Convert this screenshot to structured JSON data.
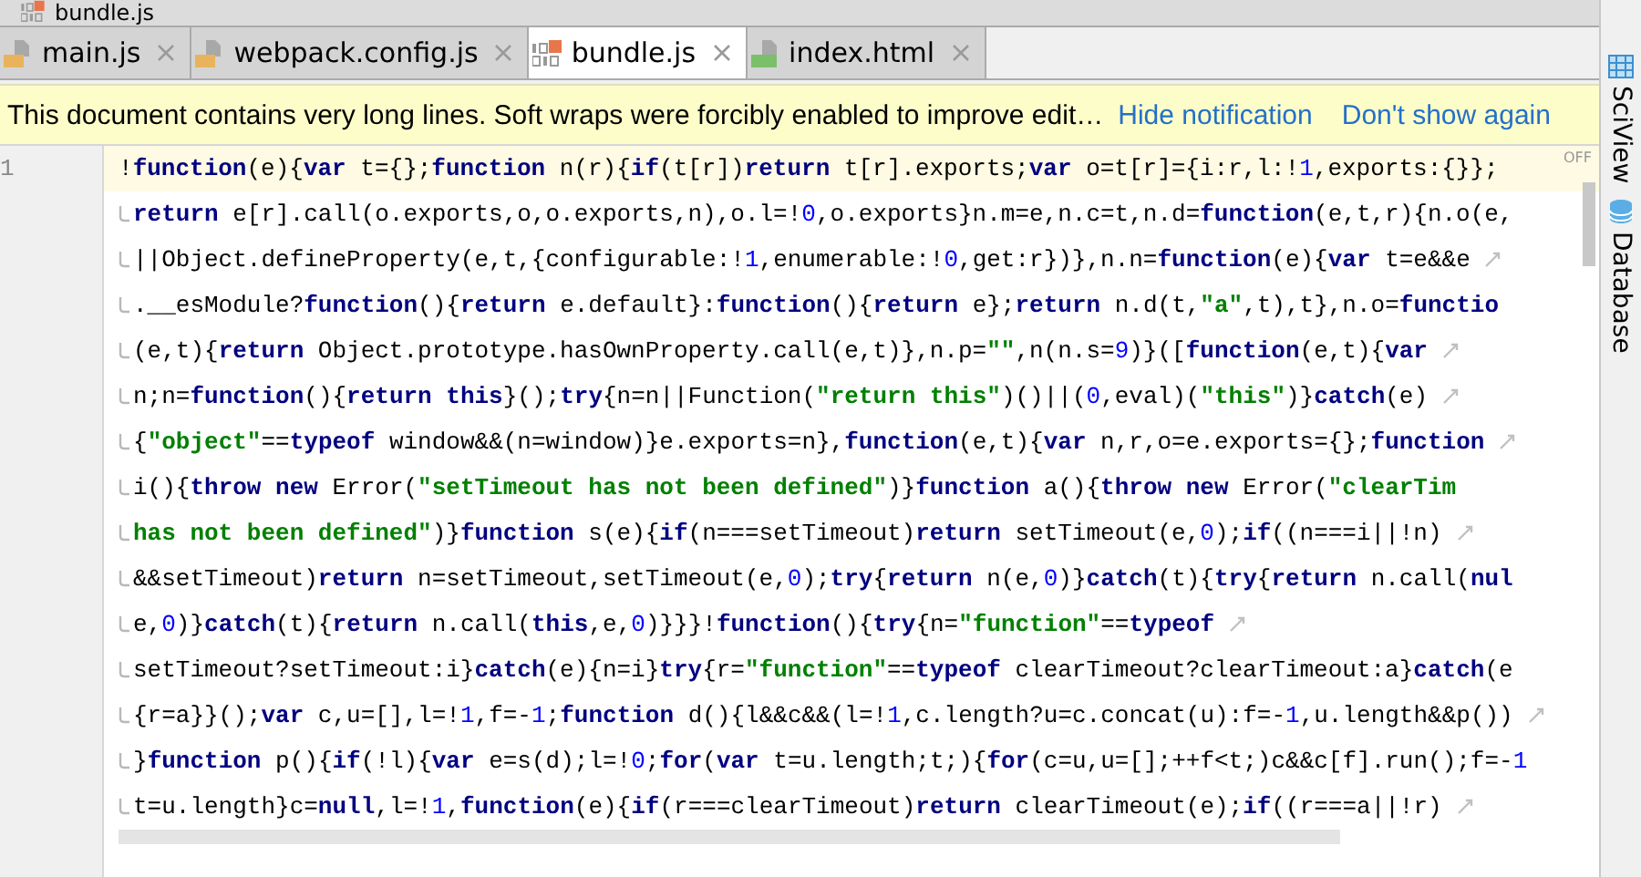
{
  "breadcrumb": {
    "label": "bundle.js",
    "kind": "binary"
  },
  "tabs": [
    {
      "label": "main.js",
      "kind": "js",
      "selected": false
    },
    {
      "label": "webpack.config.js",
      "kind": "js",
      "selected": false
    },
    {
      "label": "bundle.js",
      "kind": "binary",
      "selected": true
    },
    {
      "label": "index.html",
      "kind": "html",
      "selected": false
    }
  ],
  "notification": {
    "message": "This document contains very long lines. Soft wraps were forcibly enabled to improve edit…",
    "links": [
      "Hide notification",
      "Don't show again"
    ]
  },
  "editor": {
    "line_number": "1",
    "inspection": "OFF",
    "lines": [
      {
        "continuation": false,
        "wrap_mark": false,
        "current": true,
        "tokens": [
          {
            "kind": "plain",
            "text": "!"
          },
          {
            "kind": "keyword",
            "text": "function"
          },
          {
            "kind": "plain",
            "text": "(e){"
          },
          {
            "kind": "keyword",
            "text": "var"
          },
          {
            "kind": "plain",
            "text": " t={};"
          },
          {
            "kind": "keyword",
            "text": "function"
          },
          {
            "kind": "plain",
            "text": " n(r){"
          },
          {
            "kind": "keyword",
            "text": "if"
          },
          {
            "kind": "plain",
            "text": "(t[r])"
          },
          {
            "kind": "keyword",
            "text": "return"
          },
          {
            "kind": "plain",
            "text": " t[r].exports;"
          },
          {
            "kind": "keyword",
            "text": "var"
          },
          {
            "kind": "plain",
            "text": " o=t[r]={i:r,l:!"
          },
          {
            "kind": "number",
            "text": "1"
          },
          {
            "kind": "plain",
            "text": ",exports:{}};"
          }
        ]
      },
      {
        "continuation": true,
        "wrap_mark": false,
        "current": false,
        "tokens": [
          {
            "kind": "keyword",
            "text": "return"
          },
          {
            "kind": "plain",
            "text": " e[r].call(o.exports,o,o.exports,n),o.l=!"
          },
          {
            "kind": "number",
            "text": "0"
          },
          {
            "kind": "plain",
            "text": ",o.exports}n.m=e,n.c=t,n.d="
          },
          {
            "kind": "keyword",
            "text": "function"
          },
          {
            "kind": "plain",
            "text": "(e,t,r){n.o(e,"
          }
        ]
      },
      {
        "continuation": true,
        "wrap_mark": true,
        "current": false,
        "tokens": [
          {
            "kind": "plain",
            "text": "||Object.defineProperty(e,t,{configurable:!"
          },
          {
            "kind": "number",
            "text": "1"
          },
          {
            "kind": "plain",
            "text": ",enumerable:!"
          },
          {
            "kind": "number",
            "text": "0"
          },
          {
            "kind": "plain",
            "text": ",get:r})},n.n="
          },
          {
            "kind": "keyword",
            "text": "function"
          },
          {
            "kind": "plain",
            "text": "(e){"
          },
          {
            "kind": "keyword",
            "text": "var"
          },
          {
            "kind": "plain",
            "text": " t=e&&e"
          }
        ]
      },
      {
        "continuation": true,
        "wrap_mark": false,
        "current": false,
        "tokens": [
          {
            "kind": "plain",
            "text": ".__esModule?"
          },
          {
            "kind": "keyword",
            "text": "function"
          },
          {
            "kind": "plain",
            "text": "(){"
          },
          {
            "kind": "keyword",
            "text": "return"
          },
          {
            "kind": "plain",
            "text": " e.default}:"
          },
          {
            "kind": "keyword",
            "text": "function"
          },
          {
            "kind": "plain",
            "text": "(){"
          },
          {
            "kind": "keyword",
            "text": "return"
          },
          {
            "kind": "plain",
            "text": " e};"
          },
          {
            "kind": "keyword",
            "text": "return"
          },
          {
            "kind": "plain",
            "text": " n.d(t,"
          },
          {
            "kind": "string",
            "text": "\"a\""
          },
          {
            "kind": "plain",
            "text": ",t),t},n.o="
          },
          {
            "kind": "keyword",
            "text": "functio"
          }
        ]
      },
      {
        "continuation": true,
        "wrap_mark": true,
        "current": false,
        "tokens": [
          {
            "kind": "plain",
            "text": "(e,t){"
          },
          {
            "kind": "keyword",
            "text": "return"
          },
          {
            "kind": "plain",
            "text": " Object.prototype.hasOwnProperty.call(e,t)},n.p="
          },
          {
            "kind": "string",
            "text": "\"\""
          },
          {
            "kind": "plain",
            "text": ",n(n.s="
          },
          {
            "kind": "number",
            "text": "9"
          },
          {
            "kind": "plain",
            "text": ")}(["
          },
          {
            "kind": "keyword",
            "text": "function"
          },
          {
            "kind": "plain",
            "text": "(e,t){"
          },
          {
            "kind": "keyword",
            "text": "var"
          }
        ]
      },
      {
        "continuation": true,
        "wrap_mark": true,
        "current": false,
        "tokens": [
          {
            "kind": "plain",
            "text": "n;n="
          },
          {
            "kind": "keyword",
            "text": "function"
          },
          {
            "kind": "plain",
            "text": "(){"
          },
          {
            "kind": "keyword",
            "text": "return this"
          },
          {
            "kind": "plain",
            "text": "}();"
          },
          {
            "kind": "keyword",
            "text": "try"
          },
          {
            "kind": "plain",
            "text": "{n=n||Function("
          },
          {
            "kind": "string",
            "text": "\"return this\""
          },
          {
            "kind": "plain",
            "text": ")()||("
          },
          {
            "kind": "number",
            "text": "0"
          },
          {
            "kind": "plain",
            "text": ",eval)("
          },
          {
            "kind": "string",
            "text": "\"this\""
          },
          {
            "kind": "plain",
            "text": ")}"
          },
          {
            "kind": "keyword",
            "text": "catch"
          },
          {
            "kind": "plain",
            "text": "(e)"
          }
        ]
      },
      {
        "continuation": true,
        "wrap_mark": true,
        "current": false,
        "tokens": [
          {
            "kind": "plain",
            "text": "{"
          },
          {
            "kind": "string",
            "text": "\"object\""
          },
          {
            "kind": "plain",
            "text": "=="
          },
          {
            "kind": "keyword",
            "text": "typeof"
          },
          {
            "kind": "plain",
            "text": " window&&(n=window)}e.exports=n},"
          },
          {
            "kind": "keyword",
            "text": "function"
          },
          {
            "kind": "plain",
            "text": "(e,t){"
          },
          {
            "kind": "keyword",
            "text": "var"
          },
          {
            "kind": "plain",
            "text": " n,r,o=e.exports={};"
          },
          {
            "kind": "keyword",
            "text": "function"
          }
        ]
      },
      {
        "continuation": true,
        "wrap_mark": false,
        "current": false,
        "tokens": [
          {
            "kind": "plain",
            "text": "i(){"
          },
          {
            "kind": "keyword",
            "text": "throw new"
          },
          {
            "kind": "plain",
            "text": " Error("
          },
          {
            "kind": "string",
            "text": "\"setTimeout has not been defined\""
          },
          {
            "kind": "plain",
            "text": ")}"
          },
          {
            "kind": "keyword",
            "text": "function"
          },
          {
            "kind": "plain",
            "text": " a(){"
          },
          {
            "kind": "keyword",
            "text": "throw new"
          },
          {
            "kind": "plain",
            "text": " Error("
          },
          {
            "kind": "string",
            "text": "\"clearTim"
          }
        ]
      },
      {
        "continuation": true,
        "wrap_mark": true,
        "current": false,
        "tokens": [
          {
            "kind": "string",
            "text": "has not been defined\""
          },
          {
            "kind": "plain",
            "text": ")}"
          },
          {
            "kind": "keyword",
            "text": "function"
          },
          {
            "kind": "plain",
            "text": " s(e){"
          },
          {
            "kind": "keyword",
            "text": "if"
          },
          {
            "kind": "plain",
            "text": "(n===setTimeout)"
          },
          {
            "kind": "keyword",
            "text": "return"
          },
          {
            "kind": "plain",
            "text": " setTimeout(e,"
          },
          {
            "kind": "number",
            "text": "0"
          },
          {
            "kind": "plain",
            "text": ");"
          },
          {
            "kind": "keyword",
            "text": "if"
          },
          {
            "kind": "plain",
            "text": "((n===i||!n)"
          }
        ]
      },
      {
        "continuation": true,
        "wrap_mark": false,
        "current": false,
        "tokens": [
          {
            "kind": "plain",
            "text": "&&setTimeout)"
          },
          {
            "kind": "keyword",
            "text": "return"
          },
          {
            "kind": "plain",
            "text": " n=setTimeout,setTimeout(e,"
          },
          {
            "kind": "number",
            "text": "0"
          },
          {
            "kind": "plain",
            "text": ");"
          },
          {
            "kind": "keyword",
            "text": "try"
          },
          {
            "kind": "plain",
            "text": "{"
          },
          {
            "kind": "keyword",
            "text": "return"
          },
          {
            "kind": "plain",
            "text": " n(e,"
          },
          {
            "kind": "number",
            "text": "0"
          },
          {
            "kind": "plain",
            "text": ")}"
          },
          {
            "kind": "keyword",
            "text": "catch"
          },
          {
            "kind": "plain",
            "text": "(t){"
          },
          {
            "kind": "keyword",
            "text": "try"
          },
          {
            "kind": "plain",
            "text": "{"
          },
          {
            "kind": "keyword",
            "text": "return"
          },
          {
            "kind": "plain",
            "text": " n.call("
          },
          {
            "kind": "keyword",
            "text": "nul"
          }
        ]
      },
      {
        "continuation": true,
        "wrap_mark": true,
        "current": false,
        "tokens": [
          {
            "kind": "plain",
            "text": "e,"
          },
          {
            "kind": "number",
            "text": "0"
          },
          {
            "kind": "plain",
            "text": ")}"
          },
          {
            "kind": "keyword",
            "text": "catch"
          },
          {
            "kind": "plain",
            "text": "(t){"
          },
          {
            "kind": "keyword",
            "text": "return"
          },
          {
            "kind": "plain",
            "text": " n.call("
          },
          {
            "kind": "keyword",
            "text": "this"
          },
          {
            "kind": "plain",
            "text": ",e,"
          },
          {
            "kind": "number",
            "text": "0"
          },
          {
            "kind": "plain",
            "text": ")}}}!"
          },
          {
            "kind": "keyword",
            "text": "function"
          },
          {
            "kind": "plain",
            "text": "(){"
          },
          {
            "kind": "keyword",
            "text": "try"
          },
          {
            "kind": "plain",
            "text": "{n="
          },
          {
            "kind": "string",
            "text": "\"function\""
          },
          {
            "kind": "plain",
            "text": "=="
          },
          {
            "kind": "keyword",
            "text": "typeof"
          }
        ]
      },
      {
        "continuation": true,
        "wrap_mark": false,
        "current": false,
        "tokens": [
          {
            "kind": "plain",
            "text": "setTimeout?setTimeout:i}"
          },
          {
            "kind": "keyword",
            "text": "catch"
          },
          {
            "kind": "plain",
            "text": "(e){n=i}"
          },
          {
            "kind": "keyword",
            "text": "try"
          },
          {
            "kind": "plain",
            "text": "{r="
          },
          {
            "kind": "string",
            "text": "\"function\""
          },
          {
            "kind": "plain",
            "text": "=="
          },
          {
            "kind": "keyword",
            "text": "typeof"
          },
          {
            "kind": "plain",
            "text": " clearTimeout?clearTimeout:a}"
          },
          {
            "kind": "keyword",
            "text": "catch"
          },
          {
            "kind": "plain",
            "text": "(e"
          }
        ]
      },
      {
        "continuation": true,
        "wrap_mark": true,
        "current": false,
        "tokens": [
          {
            "kind": "plain",
            "text": "{r=a}}();"
          },
          {
            "kind": "keyword",
            "text": "var"
          },
          {
            "kind": "plain",
            "text": " c,u=[],l=!"
          },
          {
            "kind": "number",
            "text": "1"
          },
          {
            "kind": "plain",
            "text": ",f=-"
          },
          {
            "kind": "number",
            "text": "1"
          },
          {
            "kind": "plain",
            "text": ";"
          },
          {
            "kind": "keyword",
            "text": "function"
          },
          {
            "kind": "plain",
            "text": " d(){l&&c&&(l=!"
          },
          {
            "kind": "number",
            "text": "1"
          },
          {
            "kind": "plain",
            "text": ",c.length?u=c.concat(u):f=-"
          },
          {
            "kind": "number",
            "text": "1"
          },
          {
            "kind": "plain",
            "text": ",u.length&&p())"
          }
        ]
      },
      {
        "continuation": true,
        "wrap_mark": false,
        "current": false,
        "tokens": [
          {
            "kind": "plain",
            "text": "}"
          },
          {
            "kind": "keyword",
            "text": "function"
          },
          {
            "kind": "plain",
            "text": " p(){"
          },
          {
            "kind": "keyword",
            "text": "if"
          },
          {
            "kind": "plain",
            "text": "(!l){"
          },
          {
            "kind": "keyword",
            "text": "var"
          },
          {
            "kind": "plain",
            "text": " e=s(d);l=!"
          },
          {
            "kind": "number",
            "text": "0"
          },
          {
            "kind": "plain",
            "text": ";"
          },
          {
            "kind": "keyword",
            "text": "for"
          },
          {
            "kind": "plain",
            "text": "("
          },
          {
            "kind": "keyword",
            "text": "var"
          },
          {
            "kind": "plain",
            "text": " t=u.length;t;){"
          },
          {
            "kind": "keyword",
            "text": "for"
          },
          {
            "kind": "plain",
            "text": "(c=u,u=[];++f<t;)c&&c[f].run();f=-"
          },
          {
            "kind": "number",
            "text": "1"
          }
        ]
      },
      {
        "continuation": true,
        "wrap_mark": true,
        "current": false,
        "tokens": [
          {
            "kind": "plain",
            "text": "t=u.length}c="
          },
          {
            "kind": "keyword",
            "text": "null"
          },
          {
            "kind": "plain",
            "text": ",l=!"
          },
          {
            "kind": "number",
            "text": "1"
          },
          {
            "kind": "plain",
            "text": ","
          },
          {
            "kind": "keyword",
            "text": "function"
          },
          {
            "kind": "plain",
            "text": "(e){"
          },
          {
            "kind": "keyword",
            "text": "if"
          },
          {
            "kind": "plain",
            "text": "(r===clearTimeout)"
          },
          {
            "kind": "keyword",
            "text": "return"
          },
          {
            "kind": "plain",
            "text": " clearTimeout(e);"
          },
          {
            "kind": "keyword",
            "text": "if"
          },
          {
            "kind": "plain",
            "text": "((r===a||!r)"
          }
        ]
      }
    ]
  },
  "tool_strip": [
    {
      "label": "SciView",
      "kind": "grid"
    },
    {
      "label": "Database",
      "kind": "database"
    }
  ]
}
